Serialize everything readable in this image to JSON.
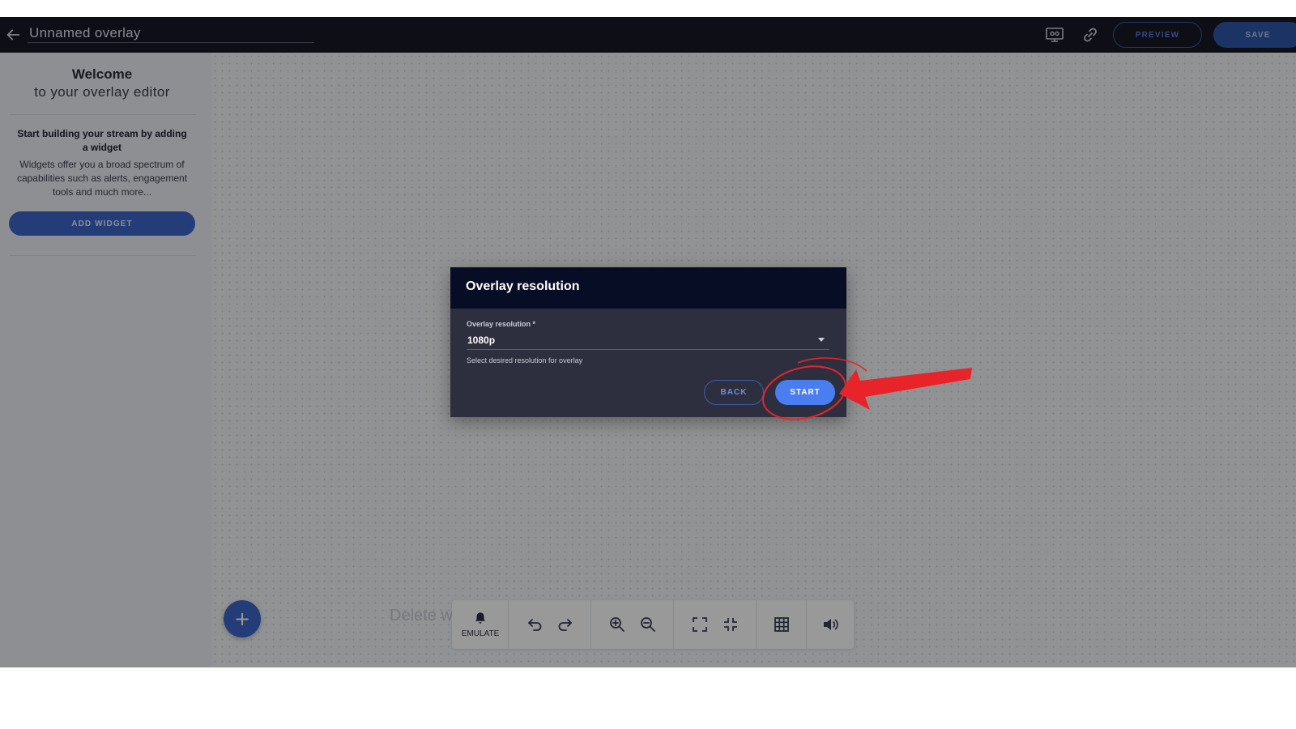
{
  "header": {
    "title": "Unnamed overlay",
    "back_icon": "arrow-left-icon",
    "monitor_icon": "monitor-settings-icon",
    "link_icon": "link-icon",
    "preview_label": "PREVIEW",
    "save_label": "SAVE"
  },
  "sidebar": {
    "welcome_title": "Welcome",
    "welcome_subtitle": "to your overlay editor",
    "start_heading": "Start building your stream by adding a widget",
    "start_description": "Widgets offer you a broad spectrum of capabilities such as alerts, engagement tools and much more...",
    "add_widget_label": "ADD WIDGET"
  },
  "canvas": {
    "delete_hint": "Delete w",
    "fab_label": "+"
  },
  "toolbar": {
    "emulate_label": "EMULATE",
    "icons": [
      "bell-icon",
      "undo-icon",
      "redo-icon",
      "zoom-in-icon",
      "zoom-out-icon",
      "fullscreen-icon",
      "exit-fullscreen-icon",
      "grid-icon",
      "volume-icon"
    ]
  },
  "dialog": {
    "title": "Overlay resolution",
    "field_label": "Overlay resolution *",
    "field_value": "1080p",
    "helper_text": "Select desired resolution for overlay",
    "back_label": "BACK",
    "start_label": "START"
  },
  "colors": {
    "accent": "#4a7ef0",
    "topbar": "#161826",
    "dialog_header": "#070d24",
    "dialog_body": "#2e2f3e",
    "annotation": "#e8242a"
  }
}
